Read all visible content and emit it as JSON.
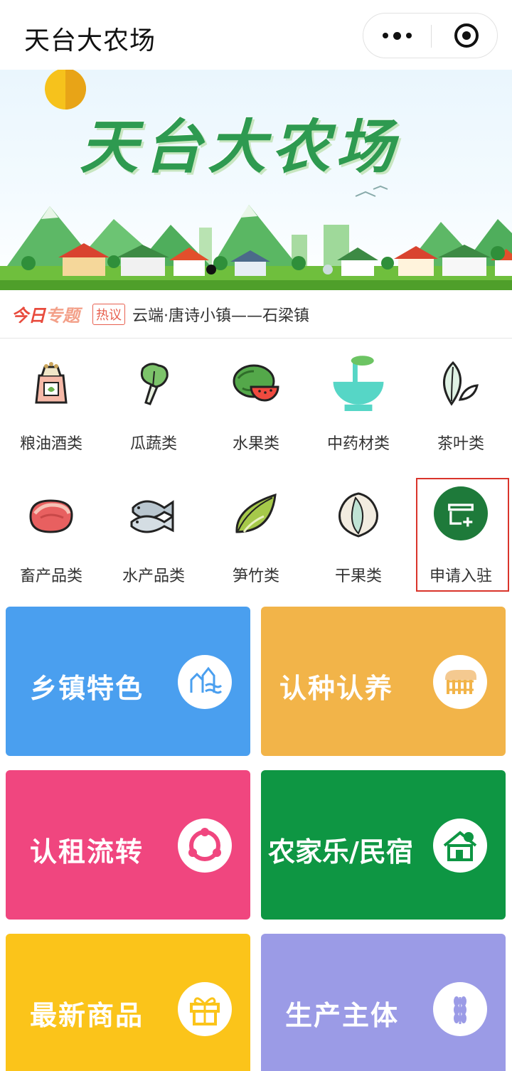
{
  "header": {
    "title": "天台大农场"
  },
  "banner": {
    "title": "天台大农场"
  },
  "topic": {
    "logo_a": "今日",
    "logo_b": "专题",
    "badge": "热议",
    "text": "云端·唐诗小镇——石梁镇"
  },
  "categories": [
    {
      "label": "粮油酒类",
      "icon": "grain-sack-icon"
    },
    {
      "label": "瓜蔬类",
      "icon": "cabbage-icon"
    },
    {
      "label": "水果类",
      "icon": "watermelon-icon"
    },
    {
      "label": "中药材类",
      "icon": "herb-mortar-icon"
    },
    {
      "label": "茶叶类",
      "icon": "tea-leaf-icon"
    },
    {
      "label": "畜产品类",
      "icon": "meat-icon"
    },
    {
      "label": "水产品类",
      "icon": "fish-icon"
    },
    {
      "label": "笋竹类",
      "icon": "bamboo-shoot-icon"
    },
    {
      "label": "干果类",
      "icon": "nut-icon"
    },
    {
      "label": "申请入驻",
      "icon": "shop-add-icon"
    }
  ],
  "tiles": [
    {
      "label": "乡镇特色",
      "color": "#4a9fef",
      "icon": "town-icon"
    },
    {
      "label": "认种认养",
      "color": "#f2b449",
      "icon": "farm-fence-icon"
    },
    {
      "label": "认租流转",
      "color": "#f0467f",
      "icon": "cycle-icon"
    },
    {
      "label": "农家乐/民宿",
      "color": "#0e9643",
      "icon": "cottage-icon"
    },
    {
      "label": "最新商品",
      "color": "#fbc41a",
      "icon": "gift-icon"
    },
    {
      "label": "生产主体",
      "color": "#9b9be6",
      "icon": "wheat-icon"
    }
  ]
}
